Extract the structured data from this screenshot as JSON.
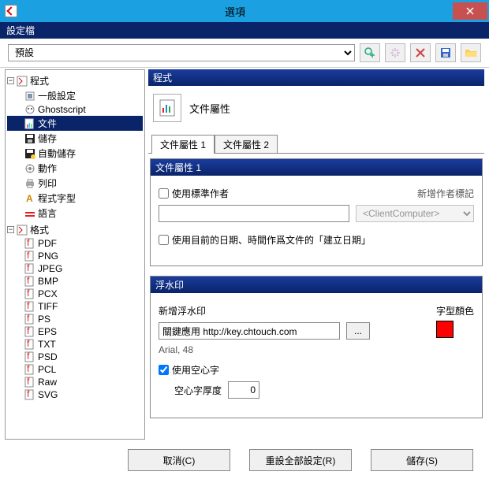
{
  "window": {
    "title": "選項"
  },
  "profile": {
    "label": "設定檔",
    "selected": "預設"
  },
  "toolbar_icons": [
    "add-profile",
    "sparkle",
    "delete-profile",
    "save-profile",
    "open-folder"
  ],
  "tree": {
    "group1": {
      "label": "程式",
      "items": [
        {
          "id": "general",
          "label": "一般設定"
        },
        {
          "id": "ghostscript",
          "label": "Ghostscript"
        },
        {
          "id": "document",
          "label": "文件",
          "selected": true
        },
        {
          "id": "save",
          "label": "儲存"
        },
        {
          "id": "autosave",
          "label": "自動儲存"
        },
        {
          "id": "actions",
          "label": "動作"
        },
        {
          "id": "print",
          "label": "列印"
        },
        {
          "id": "font",
          "label": "程式字型"
        },
        {
          "id": "language",
          "label": "語言"
        }
      ]
    },
    "group2": {
      "label": "格式",
      "items": [
        {
          "id": "pdf",
          "label": "PDF"
        },
        {
          "id": "png",
          "label": "PNG"
        },
        {
          "id": "jpeg",
          "label": "JPEG"
        },
        {
          "id": "bmp",
          "label": "BMP"
        },
        {
          "id": "pcx",
          "label": "PCX"
        },
        {
          "id": "tiff",
          "label": "TIFF"
        },
        {
          "id": "ps",
          "label": "PS"
        },
        {
          "id": "eps",
          "label": "EPS"
        },
        {
          "id": "txt",
          "label": "TXT"
        },
        {
          "id": "psd",
          "label": "PSD"
        },
        {
          "id": "pcl",
          "label": "PCL"
        },
        {
          "id": "raw",
          "label": "Raw"
        },
        {
          "id": "svg",
          "label": "SVG"
        }
      ]
    }
  },
  "content": {
    "header": "程式",
    "title": "文件屬性",
    "tabs": [
      "文件屬性 1",
      "文件屬性 2"
    ],
    "panel1": {
      "title": "文件屬性 1",
      "use_std_author": "使用標準作者",
      "author_tag_label": "新增作者標記",
      "author_tag_value": "<ClientComputer>",
      "author_value": "",
      "use_current_date": "使用目前的日期、時間作爲文件的「建立日期」"
    },
    "panel2": {
      "title": "浮水印",
      "add_watermark_label": "新增浮水印",
      "watermark_value": "關鍵應用 http://key.chtouch.com",
      "font_desc": "Arial, 48",
      "font_color_label": "字型顏色",
      "font_color": "#ff0000",
      "use_outline": "使用空心字",
      "outline_thickness_label": "空心字厚度",
      "outline_thickness_value": "0"
    }
  },
  "footer": {
    "cancel": "取消(C)",
    "reset": "重設全部設定(R)",
    "save": "儲存(S)"
  }
}
